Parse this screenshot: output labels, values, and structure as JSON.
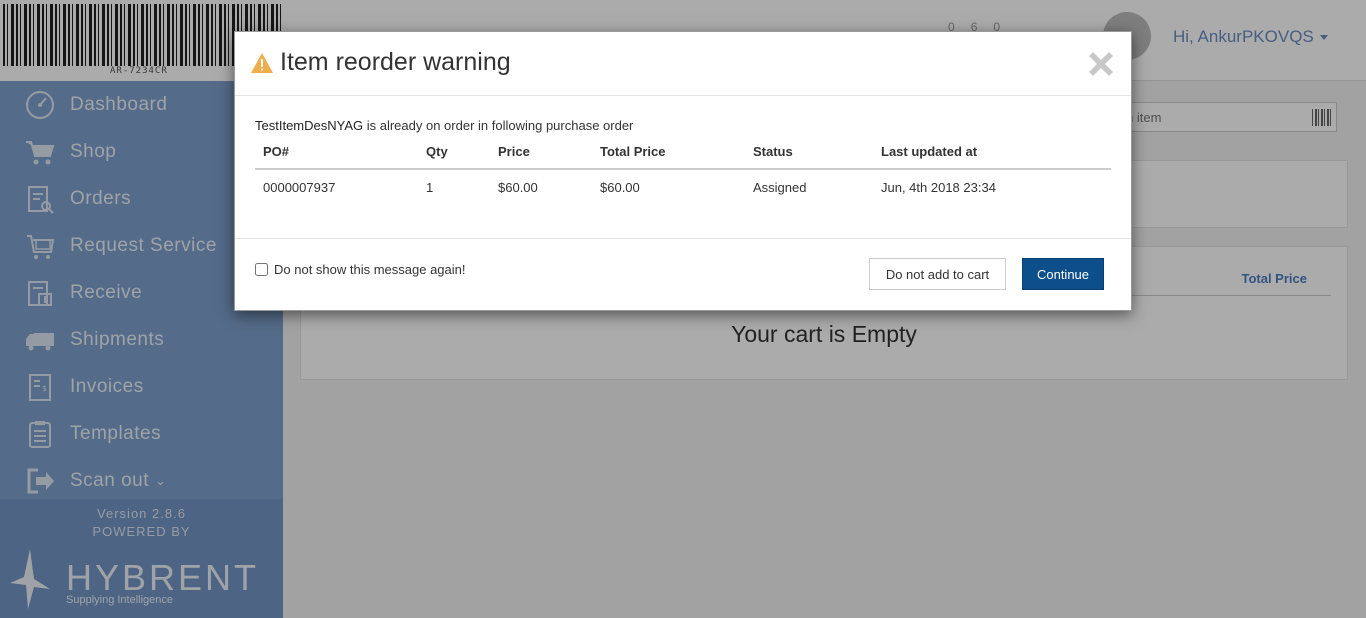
{
  "brand": {
    "barcode_text": "AR-7234CR",
    "version": "Version 2.8.6",
    "powered_by": "POWERED BY",
    "name": "HYBRENT",
    "tagline": "Supplying Intelligence"
  },
  "sidebar": {
    "items": [
      {
        "label": "Dashboard",
        "icon": "dashboard-icon"
      },
      {
        "label": "Shop",
        "icon": "cart-icon"
      },
      {
        "label": "Orders",
        "icon": "orders-icon"
      },
      {
        "label": "Request Service",
        "icon": "request-service-icon"
      },
      {
        "label": "Receive",
        "icon": "receive-icon"
      },
      {
        "label": "Shipments",
        "icon": "truck-icon"
      },
      {
        "label": "Invoices",
        "icon": "invoice-icon"
      },
      {
        "label": "Templates",
        "icon": "template-icon"
      },
      {
        "label": "Scan out",
        "icon": "scan-out-icon"
      }
    ]
  },
  "header": {
    "counter_a": "0",
    "counter_b": "6",
    "counter_c": "0",
    "greeting": "Hi, AnkurPKOVQS"
  },
  "search": {
    "placeholder": "h item"
  },
  "cart": {
    "total_price_header": "Total Price",
    "empty_message": "Your cart is Empty"
  },
  "modal": {
    "title": "Item reorder warning",
    "intro_item": "TestItemDesNYAG",
    "intro_text": " is already on order in following purchase order",
    "columns": [
      "PO#",
      "Qty",
      "Price",
      "Total Price",
      "Status",
      "Last updated at"
    ],
    "rows": [
      {
        "po": "0000007937",
        "qty": "1",
        "price": "$60.00",
        "total": "$60.00",
        "status": "Assigned",
        "updated": "Jun, 4th 2018 23:34"
      }
    ],
    "dont_show_label": "Do not show this message again!",
    "dont_add_label": "Do not add to cart",
    "continue_label": "Continue"
  },
  "colors": {
    "sidebar": "#7ea0cd",
    "primary_button": "#0d4f8b",
    "warning": "#f0ad4e",
    "link": "#4b7ec2"
  }
}
